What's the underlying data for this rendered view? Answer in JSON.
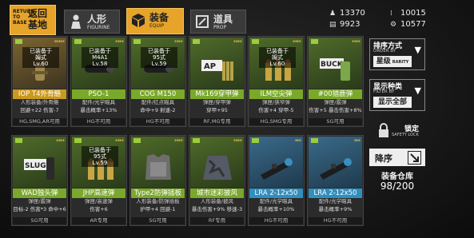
{
  "topbar": {
    "return_en": "RETURN TO BASE",
    "return_cn": "返回基地",
    "tabs": [
      {
        "cn": "人形",
        "en": "FIGURINE",
        "icon": "figure-icon"
      },
      {
        "cn": "装备",
        "en": "EQUIP",
        "icon": "box-icon"
      },
      {
        "cn": "道具",
        "en": "PROP",
        "icon": "prop-icon"
      }
    ],
    "resources": [
      {
        "icon": "manpower-icon",
        "value": "13370"
      },
      {
        "icon": "ammo-icon",
        "value": "10015"
      },
      {
        "icon": "ration-icon",
        "value": "9923"
      },
      {
        "icon": "parts-icon",
        "value": "10577"
      }
    ]
  },
  "cards": [
    {
      "stars": "*****",
      "equipped": [
        "已装备于",
        "姆式"
      ],
      "level": "Lv.60",
      "name": "IOP T4外骨骼",
      "sub": "人形装备/外骨骼",
      "eff": "回避+22 伤害-7",
      "usable": "HG,SMG,AR可用",
      "style": "gold",
      "art": "exo"
    },
    {
      "stars": "****",
      "equipped": [
        "已装备于",
        "M4A1"
      ],
      "level": "Lv.58",
      "name": "PSO-1",
      "sub": "配件/光学瞄具",
      "eff": "暴击概率+13%",
      "usable": "HG不可用",
      "style": "green",
      "art": "scope"
    },
    {
      "stars": "****",
      "equipped": [
        "已装备于",
        "95式"
      ],
      "level": "Lv.59",
      "name": "COG M150",
      "sub": "配件/红点瞄具",
      "eff": "命中+9 射速-2",
      "usable": "HG不可用",
      "style": "green",
      "art": "scope"
    },
    {
      "stars": "****",
      "equipped": [],
      "level": "",
      "name": "Mk169穿甲弹",
      "sub": "弹匣/穿甲弹",
      "eff": "穿甲+95",
      "usable": "RF,MG专用",
      "style": "green",
      "art": "ap"
    },
    {
      "stars": "****",
      "equipped": [
        "已装备于",
        "姆式"
      ],
      "level": "Lv.60",
      "name": "ILM空尖弹",
      "sub": "弹匣/狭窄弹",
      "eff": "伤害+4 穿甲-5",
      "usable": "HG,SMG专用",
      "style": "green",
      "art": "bullet"
    },
    {
      "stars": "****",
      "equipped": [],
      "level": "",
      "name": "#00猎鹿弹",
      "sub": "弹匣/霰弹",
      "eff": "伤害+5 暴击伤害+8%",
      "usable": "SG可用",
      "style": "green",
      "art": "buck"
    },
    {
      "stars": "****",
      "equipped": [],
      "level": "",
      "name": "WAD独头弹",
      "sub": "弹匣/霰弹",
      "eff": "目标-2 伤害*3 命中+6",
      "usable": "SG可用",
      "style": "green",
      "art": "slug"
    },
    {
      "stars": "****",
      "equipped": [
        "已装备于",
        "95式"
      ],
      "level": "Lv.59",
      "name": "JHP高速弹",
      "sub": "弹匣/高速弹",
      "eff": "伤害+6",
      "usable": "AR专用",
      "style": "green",
      "art": "bullet"
    },
    {
      "stars": "****",
      "equipped": [],
      "level": "",
      "name": "Type2防弹插板",
      "sub": "人形装备/防弹插板",
      "eff": "护甲+4 回避-1",
      "usable": "SG可用",
      "style": "green",
      "art": "vest"
    },
    {
      "stars": "****",
      "equipped": [],
      "level": "",
      "name": "城市迷彩披风",
      "sub": "人形装备/披风",
      "eff": "暴击伤害+9% 移速-3",
      "usable": "RF专用",
      "style": "green",
      "art": "cape"
    },
    {
      "stars": "***",
      "equipped": [],
      "level": "",
      "name": "LRA 2-12x50",
      "sub": "配件/光学瞄具",
      "eff": "暴击概率+10%",
      "usable": "HG不可用",
      "style": "blue",
      "art": "longscope"
    },
    {
      "stars": "***",
      "equipped": [],
      "level": "",
      "name": "LRA 2-12x50",
      "sub": "配件/光学瞄具",
      "eff": "暴击概率+9%",
      "usable": "HG不可用",
      "style": "blue",
      "art": "longscope"
    }
  ],
  "panel": {
    "sort_title": "排序方式",
    "sort_en": "ORDER BY",
    "sort_value": "星级",
    "sort_value_en": "RARITY",
    "filter_title": "显示种类",
    "filter_en": "FILTER BY",
    "filter_value": "显示全部",
    "lock_title": "锁定",
    "lock_en": "SAFETY LOCK",
    "order_label": "降序",
    "storage_label": "装备仓库",
    "storage_count": "98/200"
  },
  "colors": {
    "accent": "#e7a42a",
    "green": "#7aa82a",
    "blue": "#2f8fc0",
    "gold": "#c99a1f"
  }
}
